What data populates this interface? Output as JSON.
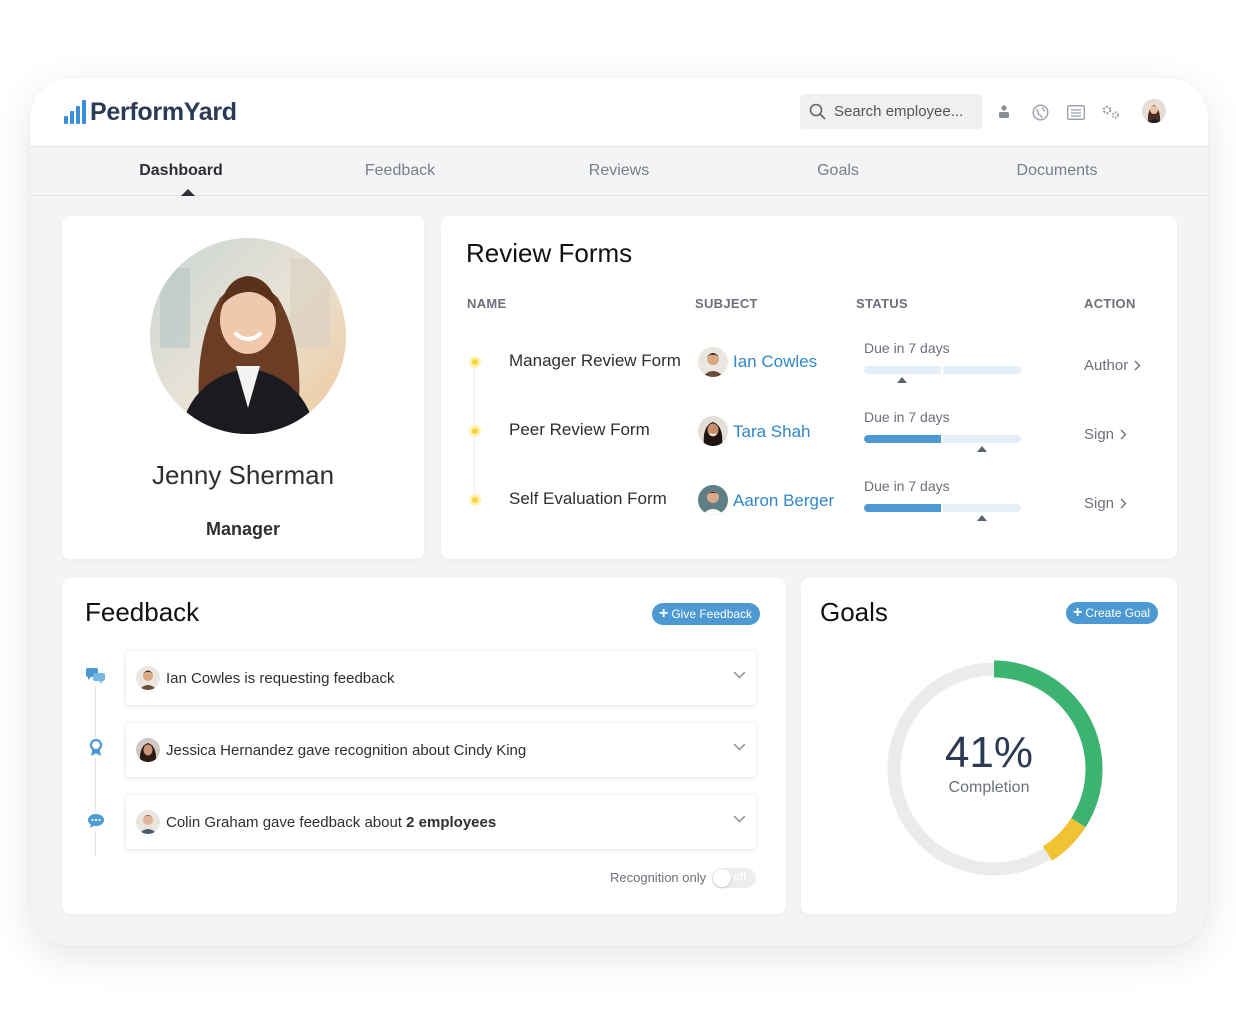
{
  "brand": {
    "logo_text": "PerformYard",
    "accent": "#3a8dd8"
  },
  "search": {
    "placeholder": "Search employee..."
  },
  "top_icons": [
    "org-chart-icon",
    "globe-icon",
    "list-icon",
    "settings-icon",
    "user-avatar"
  ],
  "tabs": [
    {
      "label": "Dashboard",
      "active": true
    },
    {
      "label": "Feedback",
      "active": false
    },
    {
      "label": "Reviews",
      "active": false
    },
    {
      "label": "Goals",
      "active": false
    },
    {
      "label": "Documents",
      "active": false
    }
  ],
  "profile": {
    "name": "Jenny Sherman",
    "role": "Manager"
  },
  "review_forms": {
    "title": "Review Forms",
    "columns": {
      "name": "NAME",
      "subject": "SUBJECT",
      "status": "STATUS",
      "action": "ACTION"
    },
    "rows": [
      {
        "name": "Manager Review Form",
        "subject": "Ian Cowles",
        "status": "Due in 7 days",
        "progress": 0.0,
        "action": "Author"
      },
      {
        "name": "Peer Review Form",
        "subject": "Tara Shah",
        "status": "Due in 7 days",
        "progress": 0.5,
        "action": "Sign"
      },
      {
        "name": "Self Evaluation Form",
        "subject": "Aaron Berger",
        "status": "Due in 7 days",
        "progress": 0.5,
        "action": "Sign"
      }
    ]
  },
  "feedback": {
    "title": "Feedback",
    "give_button": "Give Feedback",
    "items": [
      {
        "text": "Ian Cowles is requesting feedback",
        "icon": "chat-bubbles-icon"
      },
      {
        "text": "Jessica Hernandez gave recognition about Cindy King",
        "icon": "award-icon"
      },
      {
        "text_prefix": "Colin Graham gave feedback about ",
        "text_bold": "2 employees",
        "icon": "speech-bubble-icon"
      }
    ],
    "recognition_label": "Recognition only",
    "toggle_state": "off"
  },
  "goals": {
    "title": "Goals",
    "create_button": "Create Goal",
    "percent": "41%",
    "label": "Completion",
    "segments": [
      {
        "color": "#3cb371",
        "fraction": 0.34
      },
      {
        "color": "#f1c232",
        "fraction": 0.07
      }
    ]
  }
}
